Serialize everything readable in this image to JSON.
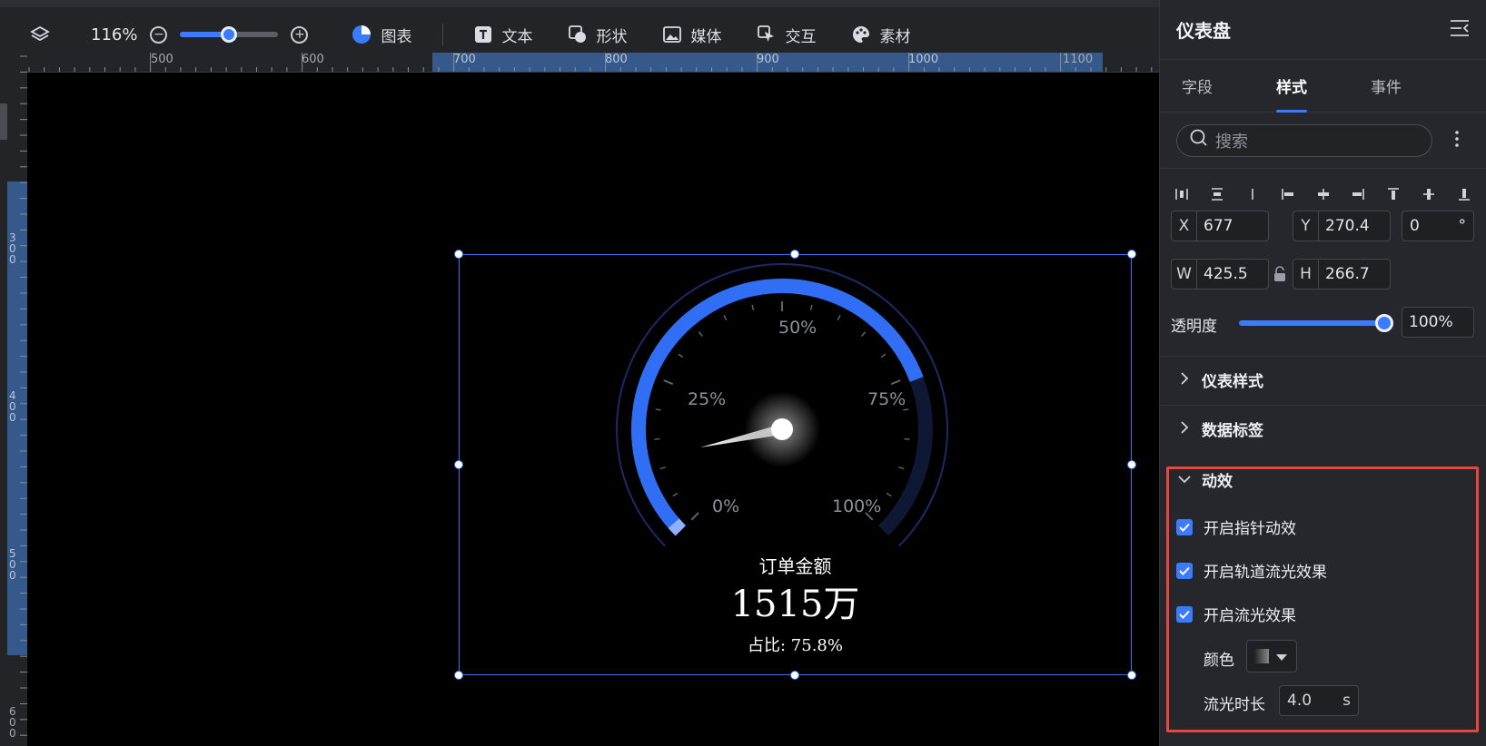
{
  "toolbar": {
    "zoom": "116%",
    "zoom_level": 0.5,
    "items": [
      {
        "label": "图表",
        "icon": "chart-pie-icon"
      },
      {
        "label": "文本",
        "icon": "text-icon"
      },
      {
        "label": "形状",
        "icon": "shape-icon"
      },
      {
        "label": "媒体",
        "icon": "image-icon"
      },
      {
        "label": "交互",
        "icon": "cursor-icon"
      },
      {
        "label": "素材",
        "icon": "palette-icon"
      }
    ]
  },
  "ruler": {
    "h_ticks": [
      "500",
      "600",
      "700",
      "800",
      "900",
      "1000",
      "1100"
    ],
    "v_ticks": [
      "300",
      "400",
      "500",
      "600"
    ]
  },
  "gauge": {
    "ticks": [
      "0%",
      "25%",
      "50%",
      "75%",
      "100%"
    ],
    "value": 0.758,
    "title": "订单金额",
    "amount": "1515万",
    "ratio_label": "占比: 75.8%",
    "colors": {
      "track": "#2f6ef5",
      "rest": "#0e1733",
      "outer": "#1b2a66"
    }
  },
  "panel": {
    "title": "仪表盘",
    "tabs": [
      {
        "label": "字段",
        "active": false
      },
      {
        "label": "样式",
        "active": true
      },
      {
        "label": "事件",
        "active": false
      }
    ],
    "search_placeholder": "搜索",
    "x_label": "X",
    "x": "677",
    "y_label": "Y",
    "y": "270.4",
    "rotation": "0",
    "rotation_unit": "°",
    "w_label": "W",
    "w": "425.5",
    "h_label": "H",
    "h": "266.7",
    "opacity_label": "透明度",
    "opacity": "100%",
    "opacity_level": 1.0,
    "sections": {
      "gauge_style": "仪表样式",
      "data_label": "数据标签",
      "animation": "动效"
    },
    "animation": {
      "pointer": "开启指针动效",
      "track_glow": "开启轨道流光效果",
      "glow": "开启流光效果",
      "color_label": "颜色",
      "duration_label": "流光时长",
      "duration": "4.0",
      "duration_unit": "s"
    }
  }
}
